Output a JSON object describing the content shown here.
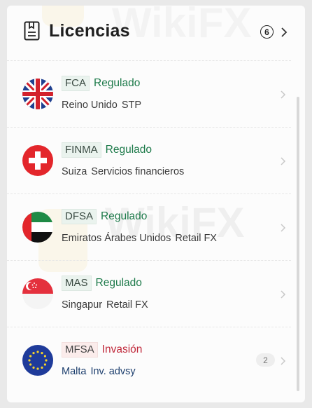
{
  "header": {
    "title": "Licencias",
    "count": "6",
    "icons": {
      "title": "document-icon",
      "more": "chevron-right-icon"
    }
  },
  "watermark": "WikiFX",
  "licenses": [
    {
      "flag": "uk-flag-icon",
      "code": "FCA",
      "status": "Regulado",
      "status_type": "regulated",
      "country": "Reino Unido",
      "type": "STP"
    },
    {
      "flag": "switzerland-flag-icon",
      "code": "FINMA",
      "status": "Regulado",
      "status_type": "regulated",
      "country": "Suiza",
      "type": "Servicios financieros"
    },
    {
      "flag": "uae-flag-icon",
      "code": "DFSA",
      "status": "Regulado",
      "status_type": "regulated",
      "country": "Emiratos Árabes Unidos",
      "type": "Retail FX"
    },
    {
      "flag": "singapore-flag-icon",
      "code": "MAS",
      "status": "Regulado",
      "status_type": "regulated",
      "country": "Singapur",
      "type": "Retail FX"
    },
    {
      "flag": "eu-flag-icon",
      "code": "MFSA",
      "status": "Invasión",
      "status_type": "exceeded",
      "country": "Malta",
      "type": "Inv. advsy",
      "count": "2"
    }
  ],
  "colors": {
    "regulated": "#1d7a4a",
    "exceeded": "#c0283a",
    "tag_green_bg": "#eaf3ee",
    "tag_red_bg": "#fbeceb"
  }
}
